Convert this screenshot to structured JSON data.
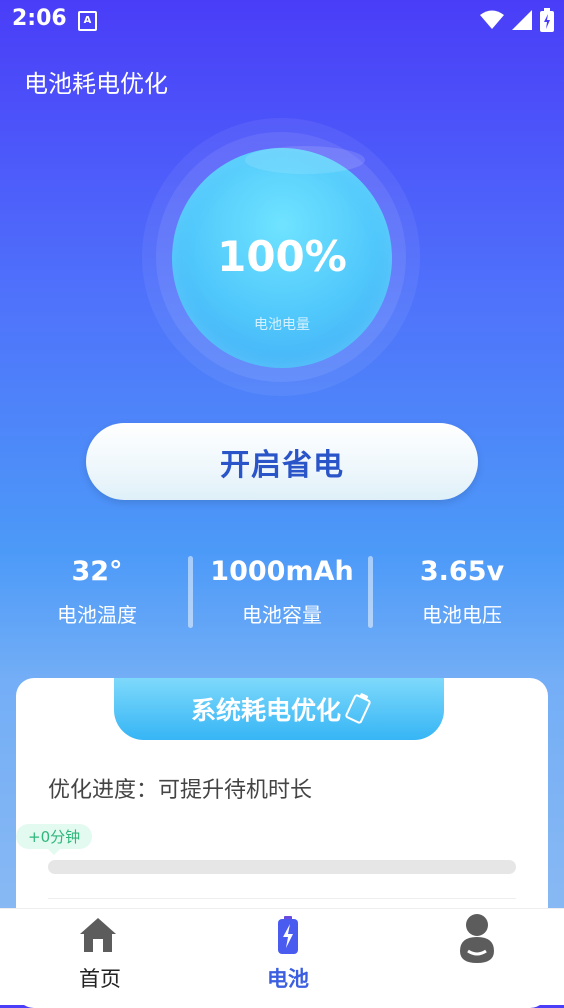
{
  "status_bar": {
    "time": "2:06",
    "notification_letter": "A"
  },
  "page_title": "电池耗电优化",
  "battery": {
    "percent": "100%",
    "percent_value": 100,
    "label": "电池电量"
  },
  "save_button": "开启省电",
  "stats": [
    {
      "value": "32°",
      "label": "电池温度"
    },
    {
      "value": "1000mAh",
      "label": "电池容量"
    },
    {
      "value": "3.65v",
      "label": "电池电压"
    }
  ],
  "optimize_card": {
    "title": "系统耗电优化",
    "progress_text": "优化进度：可提升待机时长",
    "badge": "+0分钟",
    "progress": 0
  },
  "bottom_nav": [
    {
      "label": "首页",
      "icon": "home-icon"
    },
    {
      "label": "电池",
      "icon": "battery-icon",
      "active": true
    },
    {
      "label": "",
      "icon": "profile-icon"
    }
  ],
  "colors": {
    "accent": "#3b5fe0",
    "progress": "#4cc3f5",
    "badge": "#2fb67a"
  }
}
